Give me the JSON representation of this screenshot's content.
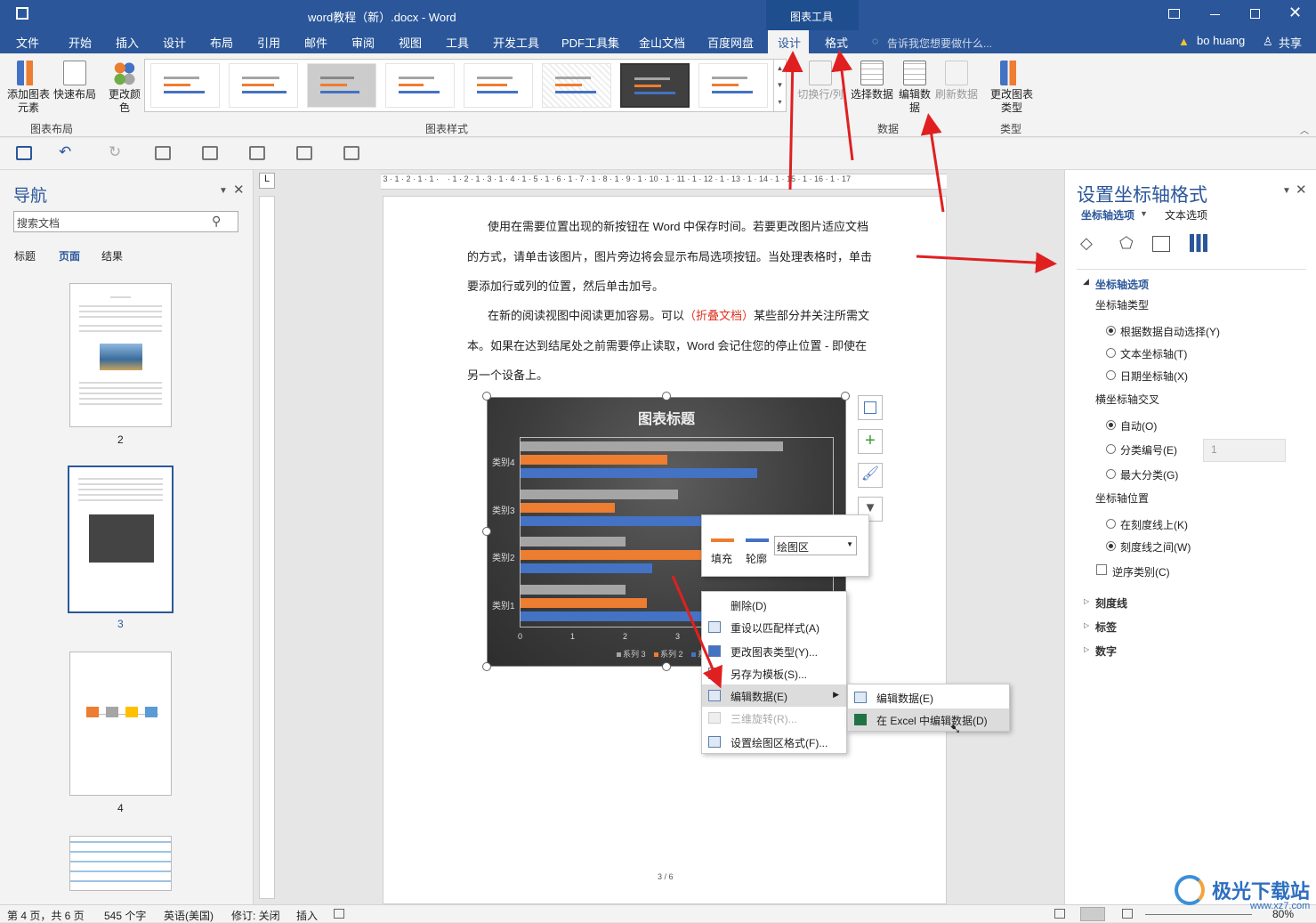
{
  "title": "word教程（新）.docx - Word",
  "ctx_tools": "图表工具",
  "tabs": [
    "文件",
    "开始",
    "插入",
    "设计",
    "布局",
    "引用",
    "邮件",
    "审阅",
    "视图",
    "工具",
    "开发工具",
    "PDF工具集",
    "金山文档",
    "百度网盘",
    "设计",
    "格式"
  ],
  "tell_me": "告诉我您想要做什么...",
  "user": "bo huang",
  "share": "共享",
  "ribbon": {
    "add_element": "添加图表元素",
    "quick_layout": "快速布局",
    "change_color": "更改颜色",
    "switch_row_col": "切换行/列",
    "select_data": "选择数据",
    "edit_data": "编辑数据",
    "refresh_data": "刷新数据",
    "change_type": "更改图表类型",
    "group_layout": "图表布局",
    "group_styles": "图表样式",
    "group_data": "数据",
    "group_type": "类型"
  },
  "nav": {
    "title": "导航",
    "search_placeholder": "搜索文档",
    "tabs": [
      "标题",
      "页面",
      "结果"
    ],
    "pages": [
      "2",
      "3",
      "4"
    ]
  },
  "doc": {
    "p1": [
      "使用在需要位置出现的新按钮在 Word 中保存时间。若要更改图片适应文档",
      "的方式，请单击该图片，图片旁边将会显示布局选项按钮。当处理表格时，单击",
      "要添加行或列的位置，然后单击加号。"
    ],
    "p2_a": "在新的阅读视图中阅读更加容易。可以",
    "p2_fold": "（折叠文档）",
    "p2_b": "某些部分并关注所需文",
    "p2": [
      "本。如果在达到结尾处之前需要停止读取，Word 会记住您的停止位置 - 即使在",
      "另一个设备上。"
    ],
    "page_no": "3 / 6"
  },
  "chart_data": {
    "type": "bar",
    "title": "图表标题",
    "categories": [
      "类别1",
      "类别2",
      "类别3",
      "类别4"
    ],
    "x_ticks": [
      "0",
      "1",
      "2",
      "3"
    ],
    "series": [
      {
        "name": "系列 3",
        "color": "#a5a5a5",
        "values": [
          2,
          2,
          3,
          5
        ]
      },
      {
        "name": "系列 2",
        "color": "#ed7d31",
        "values": [
          2.4,
          4.4,
          1.8,
          2.8
        ]
      },
      {
        "name": "系列 1",
        "color": "#4472c4",
        "values": [
          4.3,
          2.5,
          3.5,
          4.5
        ]
      }
    ],
    "legend": [
      "系列 3",
      "系列 2",
      "系列 1"
    ]
  },
  "mini": {
    "fill": "填充",
    "outline": "轮廓",
    "select_value": "绘图区"
  },
  "menu": [
    "删除(D)",
    "重设以匹配样式(A)",
    "更改图表类型(Y)...",
    "另存为模板(S)...",
    "编辑数据(E)",
    "三维旋转(R)...",
    "设置绘图区格式(F)..."
  ],
  "submenu": [
    "编辑数据(E)",
    "在 Excel 中编辑数据(D)"
  ],
  "fmt": {
    "title": "设置坐标轴格式",
    "tab_axis": "坐标轴选项",
    "tab_text": "文本选项",
    "section": "坐标轴选项",
    "axis_type": "坐标轴类型",
    "auto_select": "根据数据自动选择(Y)",
    "text_axis": "文本坐标轴(T)",
    "date_axis": "日期坐标轴(X)",
    "cross": "横坐标轴交叉",
    "auto": "自动(O)",
    "cat_no": "分类编号(E)",
    "cat_value": "1",
    "max_cat": "最大分类(G)",
    "position": "坐标轴位置",
    "on_tick": "在刻度线上(K)",
    "between": "刻度线之间(W)",
    "reverse": "逆序类别(C)",
    "tick": "刻度线",
    "labels": "标签",
    "number": "数字"
  },
  "status": {
    "page": "第 4 页，共 6 页",
    "words": "545 个字",
    "lang": "英语(美国)",
    "track": "修订: 关闭",
    "mode": "插入",
    "zoom": "80%"
  },
  "watermark": "极光下载站",
  "watermark_url": "www.xz7.com"
}
